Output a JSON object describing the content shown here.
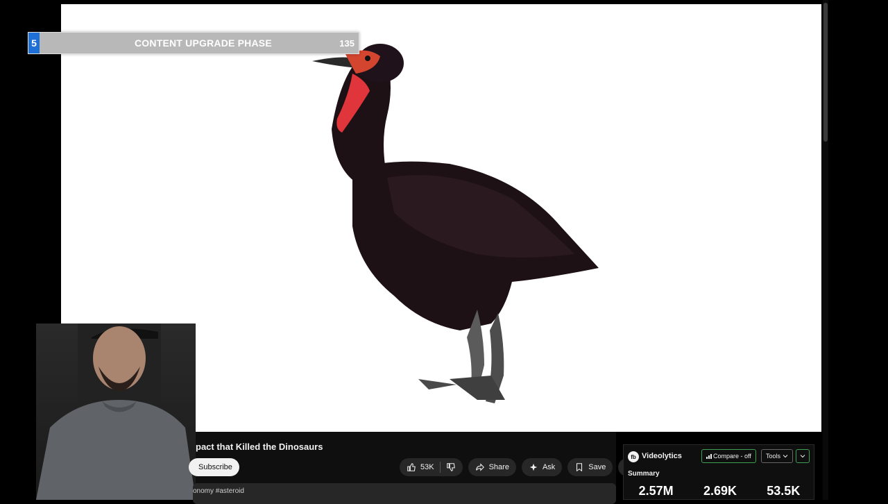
{
  "overlay": {
    "number": "5",
    "title": "CONTENT UPGRADE PHASE",
    "count": "135"
  },
  "video": {
    "title": "pact that Killed the Dinosaurs",
    "subscribe_label": "Subscribe",
    "description_snippet": "onomy #asteroid",
    "actions": {
      "likes": "53K",
      "share": "Share",
      "ask": "Ask",
      "save": "Save"
    }
  },
  "videolytics": {
    "logo": "fb",
    "name": "Videolytics",
    "compare_label": "Compare - off",
    "tools_label": "Tools",
    "summary_label": "Summary",
    "stats": [
      "2.57M",
      "2.69K",
      "53.5K"
    ]
  },
  "colors": {
    "overlay_accent": "#1e6fd6",
    "videolytics_accent": "#3ea055",
    "background": "#0f0f0f"
  },
  "icons": [
    "like-icon",
    "dislike-icon",
    "share-icon",
    "ask-icon",
    "save-icon",
    "more-icon",
    "chevron-down-icon",
    "bar-chart-icon"
  ]
}
